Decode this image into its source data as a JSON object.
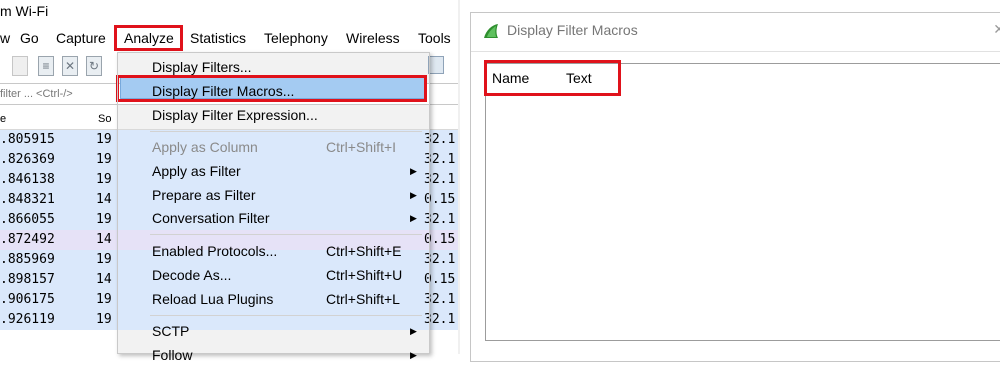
{
  "window": {
    "title": "m Wi-Fi"
  },
  "menubar": {
    "items": [
      "w",
      "Go",
      "Capture",
      "Analyze",
      "Statistics",
      "Telephony",
      "Wireless",
      "Tools"
    ]
  },
  "filter": {
    "placeholder": "filter ... <Ctrl-/>"
  },
  "columns": {
    "time": "e",
    "source": "So"
  },
  "packets": [
    {
      "time": ".805915",
      "source": "19",
      "dest": "32.1"
    },
    {
      "time": ".826369",
      "source": "19",
      "dest": "32.1"
    },
    {
      "time": ".846138",
      "source": "19",
      "dest": "32.1"
    },
    {
      "time": ".848321",
      "source": "14",
      "dest": "0.15"
    },
    {
      "time": ".866055",
      "source": "19",
      "dest": "32.1"
    },
    {
      "time": ".872492",
      "source": "14",
      "dest": "0.15"
    },
    {
      "time": ".885969",
      "source": "19",
      "dest": "32.1"
    },
    {
      "time": ".898157",
      "source": "14",
      "dest": "0.15"
    },
    {
      "time": ".906175",
      "source": "19",
      "dest": "32.1"
    },
    {
      "time": ".926119",
      "source": "19",
      "dest": "32.1"
    }
  ],
  "analyze_menu": {
    "items": [
      {
        "label": "Display Filters...",
        "shortcut": "",
        "submenu": false,
        "disabled": false
      },
      {
        "label": "Display Filter Macros...",
        "shortcut": "",
        "submenu": false,
        "disabled": false,
        "highlighted": true
      },
      {
        "label": "Display Filter Expression...",
        "shortcut": "",
        "submenu": false,
        "disabled": false
      },
      {
        "label": "Apply as Column",
        "shortcut": "Ctrl+Shift+I",
        "submenu": false,
        "disabled": true
      },
      {
        "label": "Apply as Filter",
        "shortcut": "",
        "submenu": true,
        "disabled": false
      },
      {
        "label": "Prepare as Filter",
        "shortcut": "",
        "submenu": true,
        "disabled": false
      },
      {
        "label": "Conversation Filter",
        "shortcut": "",
        "submenu": true,
        "disabled": false
      },
      {
        "label": "Enabled Protocols...",
        "shortcut": "Ctrl+Shift+E",
        "submenu": false,
        "disabled": false
      },
      {
        "label": "Decode As...",
        "shortcut": "Ctrl+Shift+U",
        "submenu": false,
        "disabled": false
      },
      {
        "label": "Reload Lua Plugins",
        "shortcut": "Ctrl+Shift+L",
        "submenu": false,
        "disabled": false
      },
      {
        "label": "SCTP",
        "shortcut": "",
        "submenu": true,
        "disabled": false
      },
      {
        "label": "Follow",
        "shortcut": "",
        "submenu": true,
        "disabled": false
      }
    ]
  },
  "dialog": {
    "title": "Display Filter Macros",
    "columns": {
      "name": "Name",
      "text": "Text"
    }
  },
  "colors": {
    "highlight": "#a4cbf2",
    "annotation": "#e0121b",
    "row_blue": "#dae8fb",
    "row_purple": "#e6e2f7"
  }
}
